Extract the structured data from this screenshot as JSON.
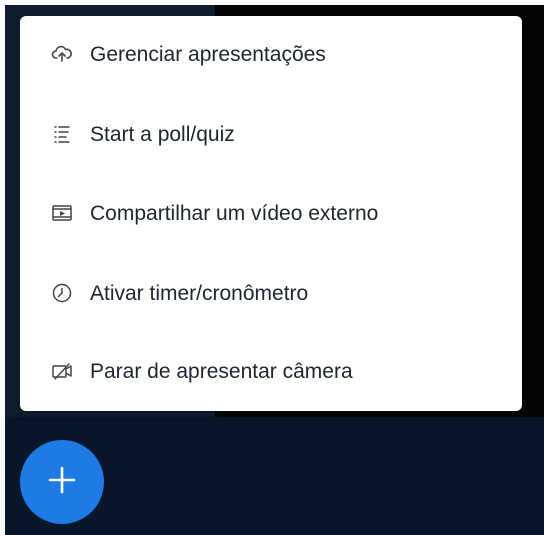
{
  "colors": {
    "menu_background": "#ffffff",
    "menu_text": "#1d2630",
    "fab_background": "#1e7be6",
    "bottom_bar": "#071628",
    "left_panel": "#0f1c2d",
    "video_area": "#050505"
  },
  "menu": {
    "items": [
      {
        "label": "Gerenciar apresentações",
        "icon": "cloud-upload-icon"
      },
      {
        "label": "Start a poll/quiz",
        "icon": "poll-list-icon"
      },
      {
        "label": "Compartilhar um vídeo externo",
        "icon": "video-icon"
      },
      {
        "label": "Ativar timer/cronômetro",
        "icon": "clock-icon"
      },
      {
        "label": "Parar de apresentar câmera",
        "icon": "video-off-icon"
      }
    ]
  },
  "fab": {
    "icon": "plus-icon"
  }
}
